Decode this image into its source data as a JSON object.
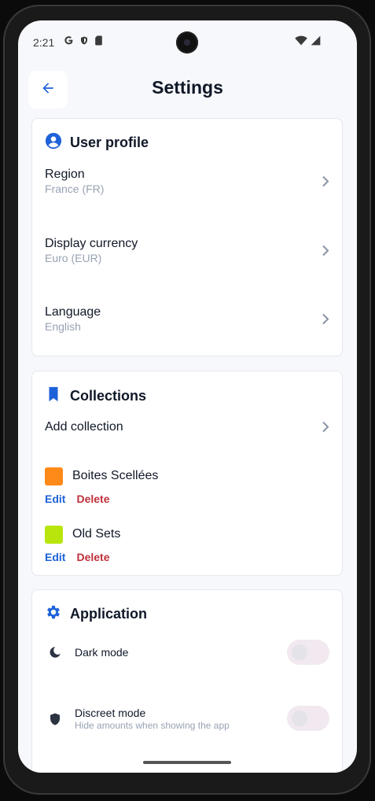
{
  "status_bar": {
    "time": "2:21",
    "left_icons": [
      "google-icon",
      "shield-status-icon",
      "sim-card-icon"
    ],
    "right_icons": [
      "wifi-icon",
      "signal-icon"
    ]
  },
  "header": {
    "title": "Settings",
    "back_icon": "arrow-left-icon"
  },
  "user_profile": {
    "title": "User profile",
    "icon": "account-circle-icon",
    "rows": [
      {
        "label": "Region",
        "value": "France (FR)"
      },
      {
        "label": "Display currency",
        "value": "Euro (EUR)"
      },
      {
        "label": "Language",
        "value": "English"
      }
    ]
  },
  "collections": {
    "title": "Collections",
    "icon": "bookmark-icon",
    "add_label": "Add collection",
    "items": [
      {
        "name": "Boites Scellées",
        "color": "#ff8a17",
        "edit_label": "Edit",
        "delete_label": "Delete"
      },
      {
        "name": "Old Sets",
        "color": "#b8e60c",
        "edit_label": "Edit",
        "delete_label": "Delete"
      }
    ]
  },
  "application": {
    "title": "Application",
    "icon": "gear-icon",
    "toggles": [
      {
        "label": "Dark mode",
        "sublabel": "",
        "icon": "moon-icon",
        "on": false
      },
      {
        "label": "Discreet mode",
        "sublabel": "Hide amounts when showing the app",
        "icon": "shield-icon",
        "on": false
      }
    ]
  },
  "colors": {
    "accent": "#1e62d9",
    "danger": "#c0303a",
    "background": "#f7f8fb"
  }
}
